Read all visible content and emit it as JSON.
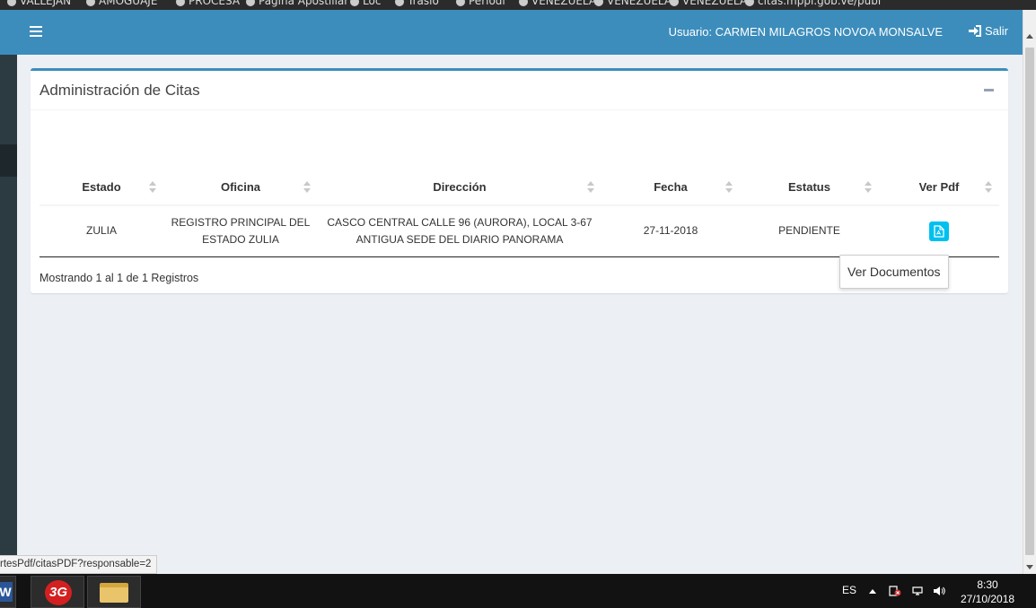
{
  "bookmarks": [
    "VALLEJAN",
    "AMOGUAJE",
    "PROCESA",
    "Pagina Apostillar",
    "Loc",
    "Traslo",
    "Periodi",
    "VENEZUELA",
    "VENEZUELA",
    "VENEZUELA",
    "citas.mppi.gob.ve/publ"
  ],
  "header": {
    "user_label": "Usuario: CARMEN MILAGROS NOVOA MONSALVE",
    "logout_label": "Salir"
  },
  "box": {
    "title": "Administración de Citas"
  },
  "table": {
    "columns": [
      "Estado",
      "Oficina",
      "Dirección",
      "Fecha",
      "Estatus",
      "Ver Pdf"
    ],
    "rows": [
      {
        "estado": "ZULIA",
        "oficina_line1": "REGISTRO PRINCIPAL DEL",
        "oficina_line2": "ESTADO ZULIA",
        "direccion_line1": "CASCO CENTRAL CALLE 96 (AURORA), LOCAL 3-67",
        "direccion_line2": "ANTIGUA SEDE DEL DIARIO PANORAMA",
        "fecha": "27-11-2018",
        "estatus": "PENDIENTE"
      }
    ]
  },
  "info_text": "Mostrando 1 al 1 de 1 Registros",
  "tooltip_text": "Ver Documentos",
  "status_url": "rtesPdf/citasPDF?responsable=2",
  "taskbar": {
    "apps": [
      "word-icon",
      "3g-icon",
      "file-explorer-icon"
    ],
    "language": "ES",
    "time": "8:30",
    "date": "27/10/2018"
  },
  "colors": {
    "header": "#3c8dbc",
    "sidebar": "#2c3b41",
    "pdf_button": "#00c0ef",
    "background": "#ecf0f5"
  }
}
